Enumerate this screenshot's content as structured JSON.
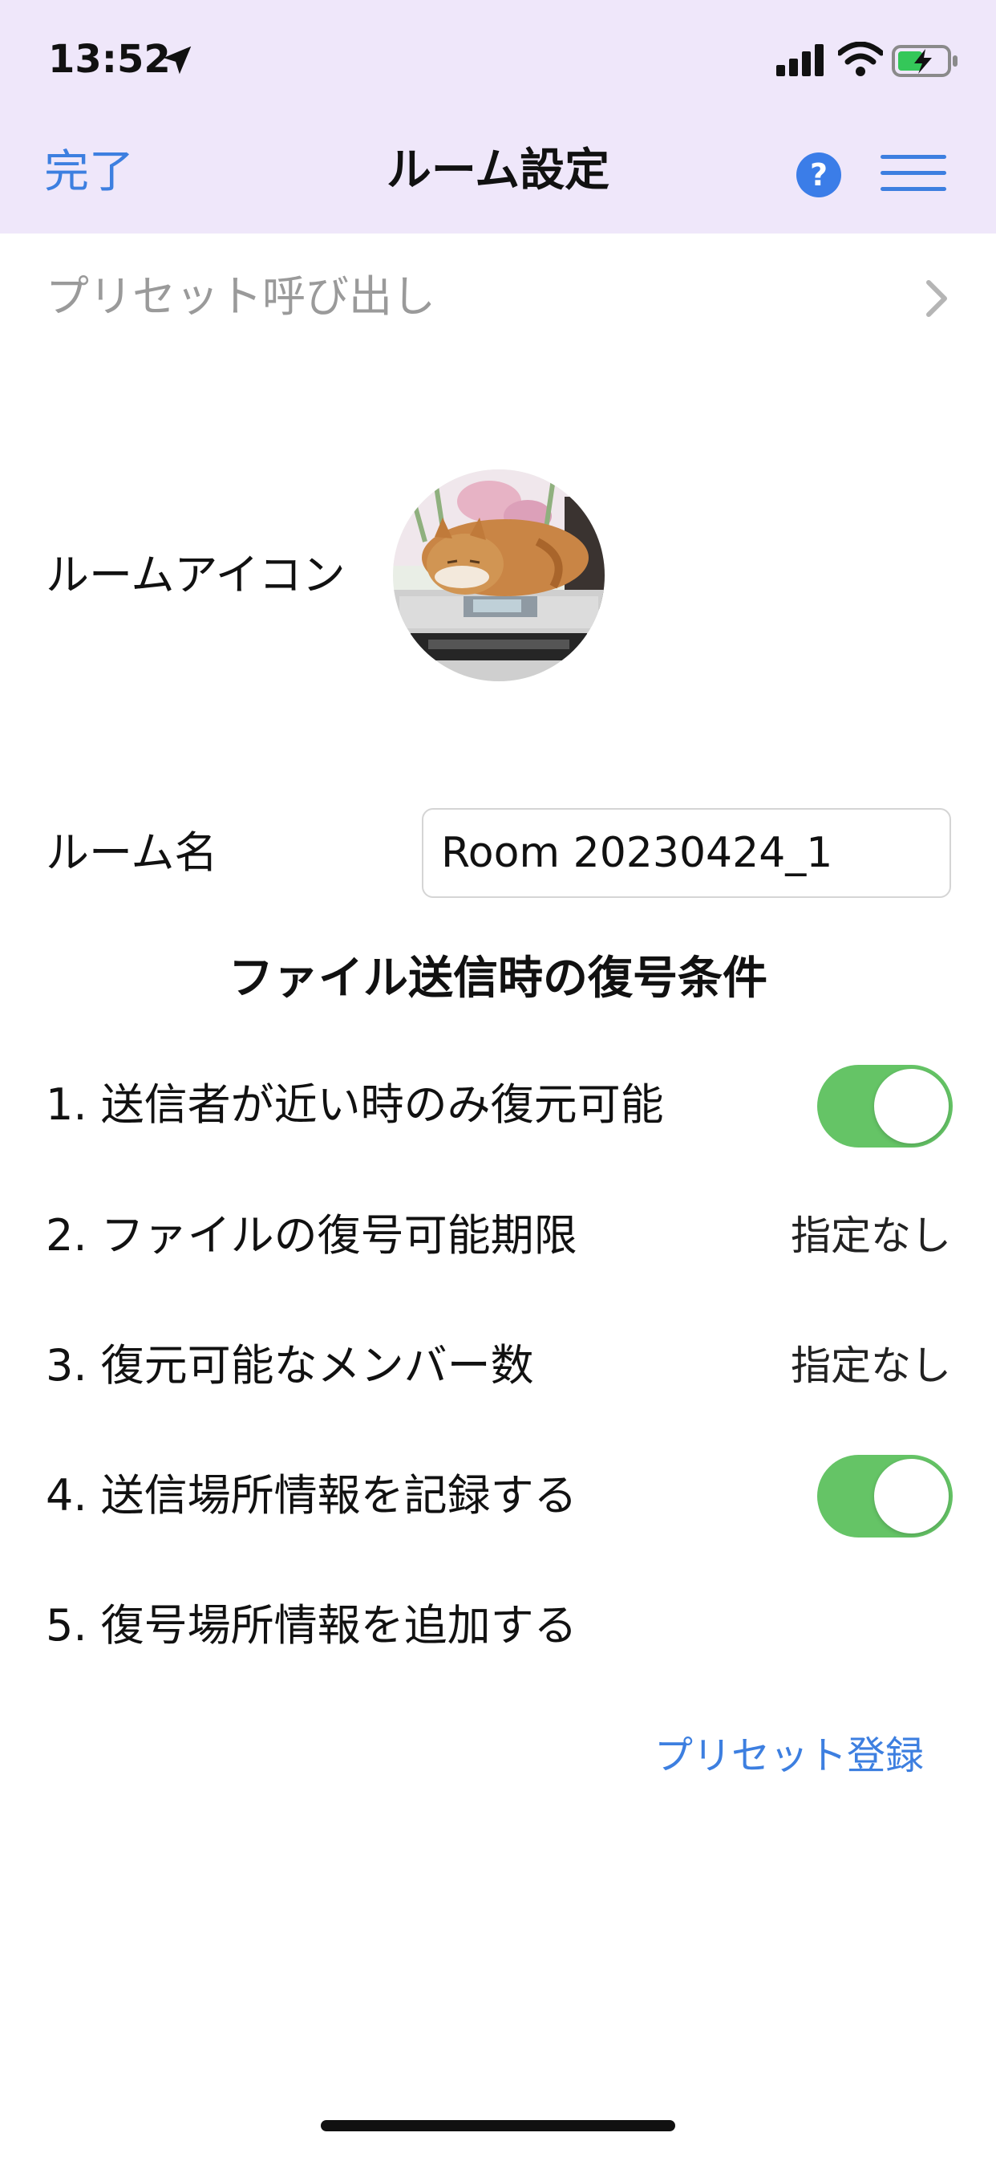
{
  "status_bar": {
    "time": "13:52"
  },
  "nav": {
    "done_label": "完了",
    "title": "ルーム設定",
    "help_label": "?"
  },
  "preset": {
    "recall_label": "プリセット呼び出し",
    "register_label": "プリセット登録"
  },
  "room_icon": {
    "label": "ルームアイコン"
  },
  "room_name": {
    "label": "ルーム名",
    "value": "Room 20230424_1"
  },
  "decryption": {
    "section_title": "ファイル送信時の復号条件",
    "items": [
      {
        "label": "1. 送信者が近い時のみ復元可能",
        "toggle_on": true
      },
      {
        "label": "2. ファイルの復号可能期限",
        "value": "指定なし"
      },
      {
        "label": "3. 復元可能なメンバー数",
        "value": "指定なし"
      },
      {
        "label": "4. 送信場所情報を記録する",
        "toggle_on": true
      },
      {
        "label": "5. 復号場所情報を追加する"
      }
    ]
  },
  "colors": {
    "header_background": "#efe7fa",
    "accent_blue": "#3d7fe0",
    "toggle_green": "#65c466"
  },
  "icons": {
    "location": "location-arrow-icon",
    "signal": "cellular-signal-icon",
    "wifi": "wifi-icon",
    "battery": "battery-charging-icon",
    "help": "question-icon",
    "menu": "hamburger-menu-icon",
    "chevron": "chevron-right-icon"
  }
}
